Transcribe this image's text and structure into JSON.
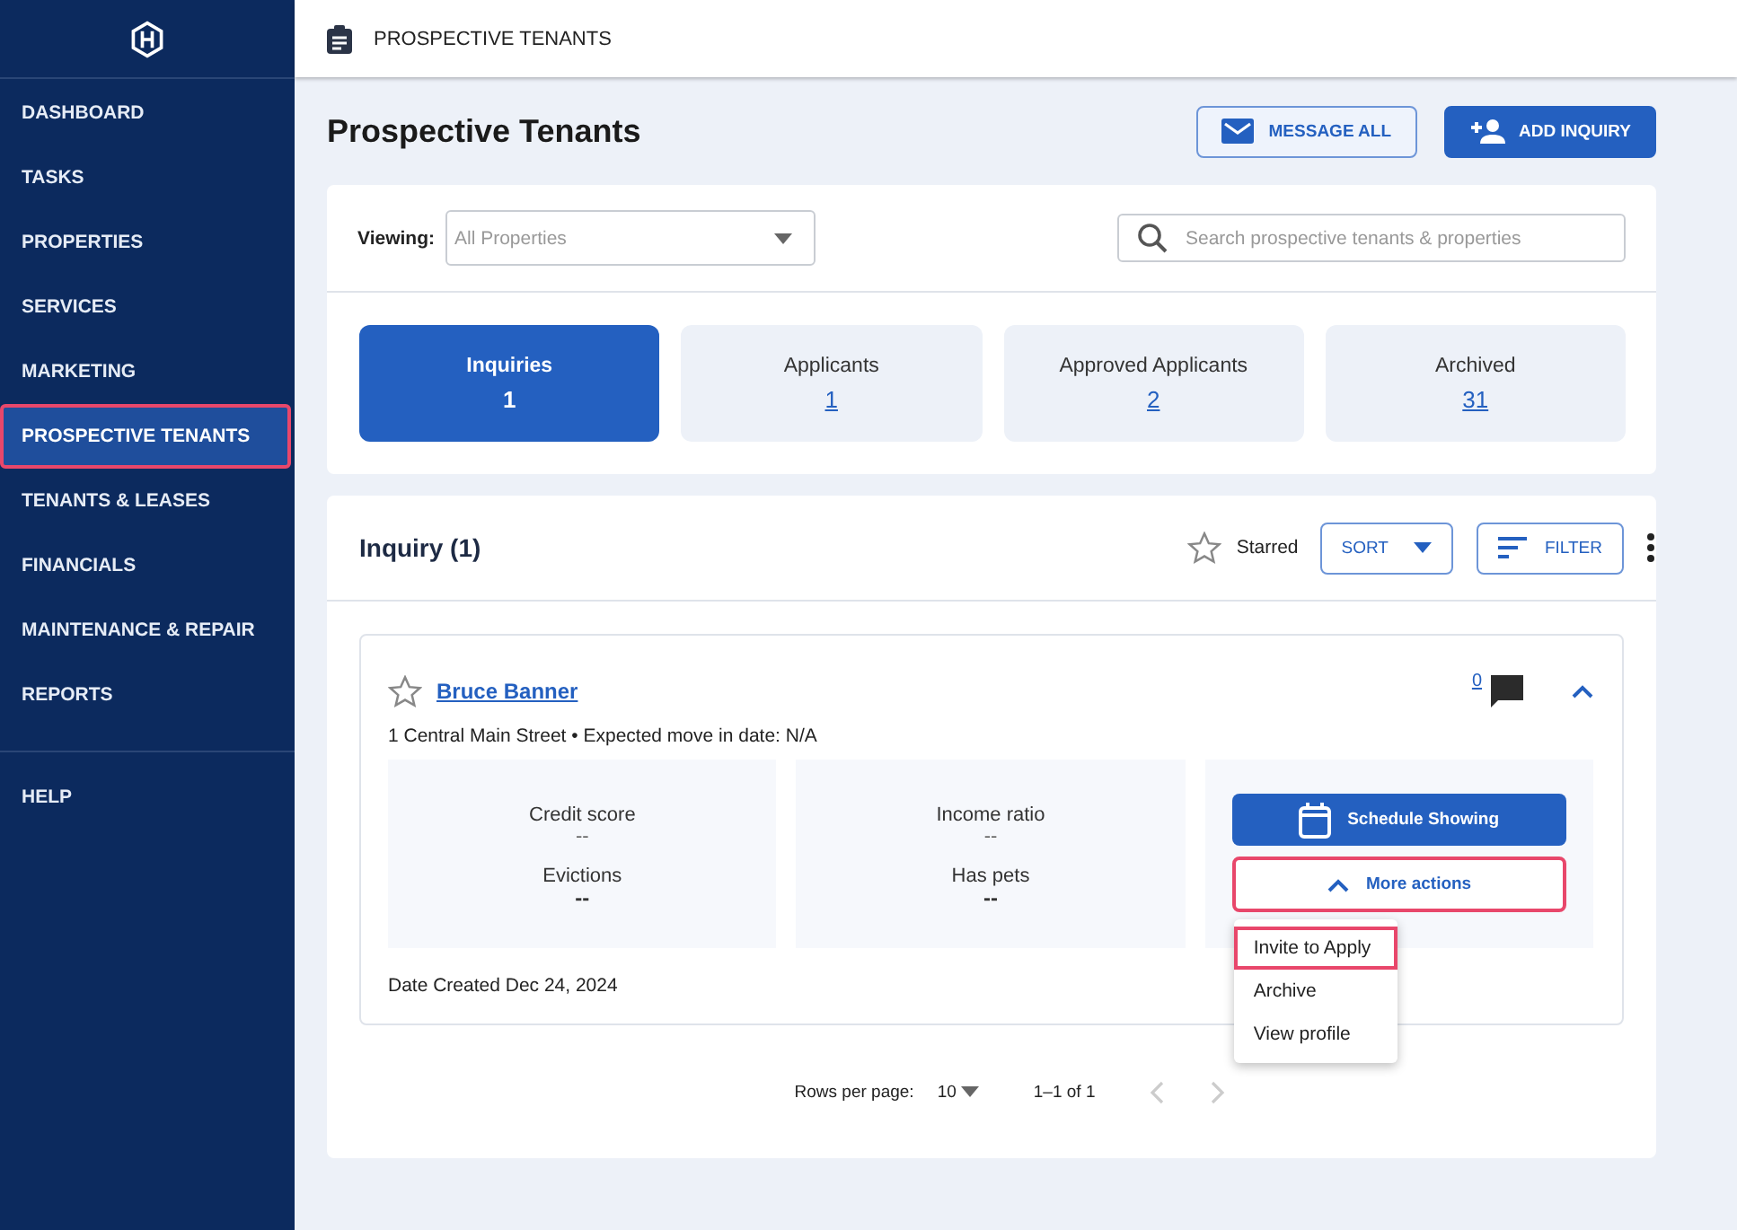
{
  "sidebar": {
    "items": [
      {
        "label": "DASHBOARD",
        "selected": false,
        "highlighted": false
      },
      {
        "label": "TASKS",
        "selected": false,
        "highlighted": false
      },
      {
        "label": "PROPERTIES",
        "selected": false,
        "highlighted": false
      },
      {
        "label": "SERVICES",
        "selected": false,
        "highlighted": false
      },
      {
        "label": "MARKETING",
        "selected": false,
        "highlighted": false
      },
      {
        "label": "PROSPECTIVE TENANTS",
        "selected": true,
        "highlighted": true
      },
      {
        "label": "TENANTS & LEASES",
        "selected": false,
        "highlighted": false
      },
      {
        "label": "FINANCIALS",
        "selected": false,
        "highlighted": false
      },
      {
        "label": "MAINTENANCE & REPAIR",
        "selected": false,
        "highlighted": false
      },
      {
        "label": "REPORTS",
        "selected": false,
        "highlighted": false
      }
    ],
    "footer_items": [
      {
        "label": "HELP",
        "selected": false,
        "highlighted": false
      }
    ]
  },
  "breadcrumb": "PROSPECTIVE TENANTS",
  "page_title": "Prospective Tenants",
  "header_buttons": [
    {
      "label": "MESSAGE ALL",
      "kind": "outline"
    },
    {
      "label": "ADD INQUIRY",
      "kind": "primary"
    }
  ],
  "filters": {
    "viewing_label": "Viewing:",
    "property_select": {
      "placeholder": "All Properties"
    },
    "search": {
      "placeholder": "Search prospective tenants & properties"
    }
  },
  "stat_tabs": [
    {
      "label": "Inquiries",
      "count": "1",
      "selected": true
    },
    {
      "label": "Applicants",
      "count": "1",
      "selected": false
    },
    {
      "label": "Approved Applicants",
      "count": "2",
      "selected": false
    },
    {
      "label": "Archived",
      "count": "31",
      "selected": false
    }
  ],
  "list": {
    "title": "Inquiry (1)",
    "starred_label": "Starred",
    "sort_label": "SORT",
    "filter_label": "FILTER",
    "inquiries": [
      {
        "name": "Bruce Banner",
        "starred": false,
        "comment_count": "0",
        "expanded": true,
        "details": "1 Central Main Street • Expected move in date: N/A",
        "metrics": [
          [
            {
              "label": "Credit score",
              "value": "--"
            },
            {
              "label": "Evictions",
              "value": "--"
            }
          ],
          [
            {
              "label": "Income ratio",
              "value": "--"
            },
            {
              "label": "Has pets",
              "value": "--"
            }
          ]
        ],
        "primary_action": "Schedule Showing",
        "more_actions": {
          "label": "More actions",
          "highlighted": true,
          "expanded": true,
          "menu": [
            {
              "label": "Invite to Apply",
              "highlighted": true
            },
            {
              "label": "Archive",
              "highlighted": false
            },
            {
              "label": "View profile",
              "highlighted": false
            }
          ]
        },
        "date_created": "Date Created Dec 24, 2024"
      }
    ],
    "pagination": {
      "rows_label": "Rows per page:",
      "rows_value": "10",
      "range": "1–1 of 1"
    }
  }
}
